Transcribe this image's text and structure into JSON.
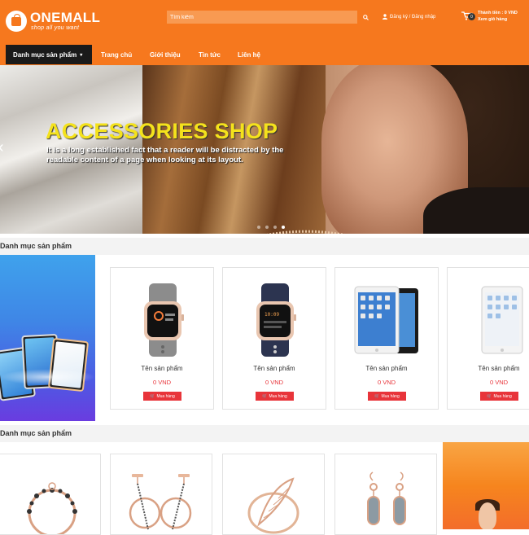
{
  "header": {
    "brand": "ONEMALL",
    "tagline": "shop all you want",
    "search_placeholder": "Tìm kiếm",
    "login_label": "Đăng ký / Đăng nhập",
    "cart": {
      "count": "0",
      "total_label": "Thành tiền : 0 VND",
      "view_label": "Xem giỏ hàng"
    }
  },
  "nav": {
    "category_label": "Danh mục sản phẩm",
    "links": [
      "Trang chủ",
      "Giới thiệu",
      "Tin tức",
      "Liên hệ"
    ]
  },
  "banner": {
    "title": "ACCESSORIES SHOP",
    "text": "It is a long established fact that a reader will be distracted by the readable content of a page when looking at its layout."
  },
  "sections": [
    {
      "title": "Danh mục sản phẩm",
      "products": [
        {
          "name": "Tên sản phẩm",
          "price": "0 VND",
          "buy_label": "Mua hàng"
        },
        {
          "name": "Tên sản phẩm",
          "price": "0 VND",
          "buy_label": "Mua hàng"
        },
        {
          "name": "Tên sản phẩm",
          "price": "0 VND",
          "buy_label": "Mua hàng"
        },
        {
          "name": "Tên sản phẩm",
          "price": "0 VND",
          "buy_label": "Mua hàng"
        }
      ]
    },
    {
      "title": "Danh mục sản phẩm"
    }
  ],
  "colors": {
    "primary": "#f6781e",
    "price": "#e8343a",
    "banner_title": "#f4e21c"
  }
}
